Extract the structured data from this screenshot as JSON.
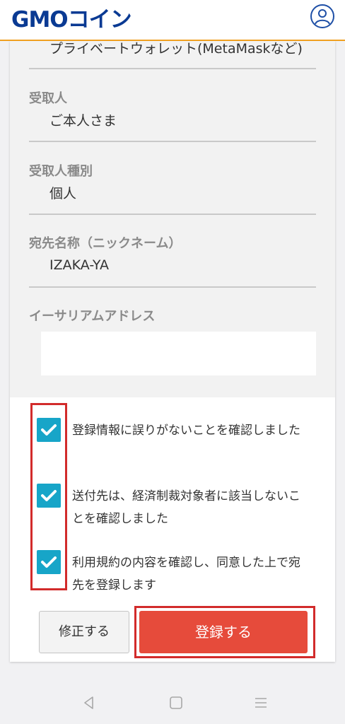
{
  "header": {
    "logo_text": "GMOコイン",
    "account_icon": "user-circle-icon"
  },
  "prev_value": "プライベートウォレット(MetaMaskなど)",
  "fields": [
    {
      "label": "受取人",
      "value": "ご本人さま"
    },
    {
      "label": "受取人種別",
      "value": "個人"
    },
    {
      "label": "宛先名称（ニックネーム）",
      "value": "IZAKA-YA"
    },
    {
      "label": "イーサリアムアドレス",
      "value": ""
    }
  ],
  "checkboxes": [
    {
      "label": "登録情報に誤りがないことを確認しました",
      "checked": true
    },
    {
      "label": "送付先は、経済制裁対象者に該当しないことを確認しました",
      "checked": true
    },
    {
      "label": "利用規約の内容を確認し、同意した上で宛先を登録します",
      "checked": true
    }
  ],
  "buttons": {
    "edit": "修正する",
    "register": "登録する"
  },
  "colors": {
    "brand": "#0a3a93",
    "accent_border": "#f0a020",
    "checkbox": "#17a5c8",
    "register": "#e64b3b",
    "highlight": "#d22b2b"
  },
  "navbar": {
    "icons": [
      "back-icon",
      "home-icon",
      "recents-icon"
    ]
  }
}
